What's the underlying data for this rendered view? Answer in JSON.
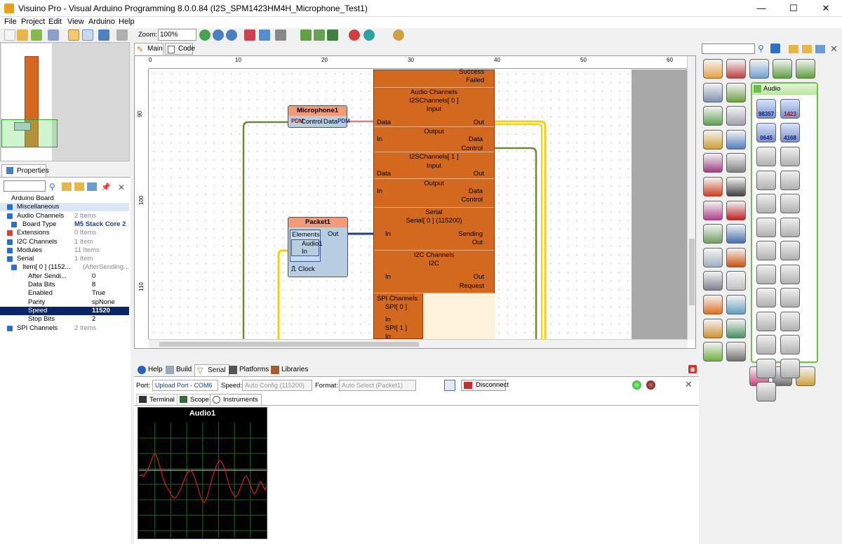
{
  "window": {
    "title": "Visuino Pro - Visual Arduino Programming 8.0.0.84 (I2S_SPM1423HM4H_Microphone_Test1)",
    "min": "—",
    "max": "☐",
    "close": "✕"
  },
  "menu": [
    "File",
    "Project",
    "Edit",
    "View",
    "Arduino",
    "Help"
  ],
  "toolbar": {
    "zoom_label": "Zoom:",
    "zoom_value": "100%"
  },
  "props": {
    "tab": "Properties",
    "rows": [
      {
        "label": "Arduino Board",
        "value": "",
        "indent": 0
      },
      {
        "label": "Miscellaneous",
        "value": "",
        "indent": 1
      },
      {
        "label": "Audio Channels",
        "value": "2 Items",
        "indent": 1
      },
      {
        "label": "Board Type",
        "value": "M5 Stack Core 2",
        "indent": 2
      },
      {
        "label": "Extensions",
        "value": "0 Items",
        "indent": 1
      },
      {
        "label": "I2C Channels",
        "value": "1 Item",
        "indent": 1
      },
      {
        "label": "Modules",
        "value": "11 Items",
        "indent": 1
      },
      {
        "label": "Serial",
        "value": "1 Item",
        "indent": 1
      },
      {
        "label": "Item[ 0 ] (1152...",
        "value": "(AfterSending...",
        "indent": 2
      },
      {
        "label": "After Sendi...",
        "value": "0",
        "indent": 3
      },
      {
        "label": "Data Bits",
        "value": "8",
        "indent": 3
      },
      {
        "label": "Enabled",
        "value": "True",
        "indent": 3
      },
      {
        "label": "Parity",
        "value": "spNone",
        "indent": 3
      },
      {
        "label": "Speed",
        "value": "11520",
        "indent": 3
      },
      {
        "label": "Stop Bits",
        "value": "2",
        "indent": 3
      },
      {
        "label": "SPI Channels",
        "value": "2 Items",
        "indent": 1
      }
    ]
  },
  "editor": {
    "tabs": [
      "Main",
      "Code"
    ],
    "ruler_top": [
      "0",
      "10",
      "20",
      "30",
      "40",
      "50",
      "60"
    ],
    "ruler_left": [
      "90",
      "100",
      "110"
    ]
  },
  "blocks": {
    "microphone": {
      "title": "Microphone1",
      "pin_in": "Control",
      "pin_out": "Data"
    },
    "packet": {
      "title": "Packet1",
      "elements": "Elements",
      "out": "Out",
      "audio": "Audio1",
      "in": "In",
      "clock": "Clock"
    },
    "board": {
      "success": "Success",
      "failed": "Failed",
      "audio_channels": "Audio Channels",
      "i2s0": "I2SChannels[ 0 ]",
      "input": "Input",
      "data": "Data",
      "out": "Out",
      "output": "Output",
      "in": "In",
      "control": "Control",
      "i2s1": "I2SChannels[ 1 ]",
      "serial": "Serial",
      "serial0": "Serial[ 0 ] (115200)",
      "sending": "Sending",
      "i2c_channels": "I2C Channels",
      "i2c": "I2C",
      "request": "Request",
      "spi_channels": "SPI Channels",
      "spi0": "SPI[ 0 ]",
      "spi1": "SPI[ 1 ]"
    }
  },
  "bottom": {
    "tabs": [
      "Help",
      "Build",
      "Serial",
      "Platforms",
      "Libraries"
    ],
    "port_label": "Port:",
    "port_value": "Upload Port - COM6",
    "speed_label": "Speed:",
    "speed_value": "Auto Config (115200)",
    "format_label": "Format:",
    "format_value": "Auto Select (Packet1)",
    "disconnect": "Disconnect",
    "subtabs": [
      "Terminal",
      "Scope",
      "Instruments"
    ],
    "scope_title": "Audio1"
  },
  "palette": {
    "group_title": "Audio",
    "tiles": [
      "98357",
      "1423",
      "0645",
      "4168"
    ]
  },
  "colors": {
    "block_orange": "#d2691e",
    "wire_yellow": "#f2d20a",
    "wire_green": "#6a8a3a",
    "scope_trace": "#c02020"
  },
  "scope_data": [
    0.45,
    0.46,
    0.44,
    0.47,
    0.42,
    0.4,
    0.36,
    0.3,
    0.24,
    0.18,
    0.14,
    0.16,
    0.22,
    0.3,
    0.38,
    0.46,
    0.52,
    0.58,
    0.62,
    0.66,
    0.7,
    0.74,
    0.76,
    0.78,
    0.76,
    0.72,
    0.68,
    0.64,
    0.58,
    0.52,
    0.46,
    0.42,
    0.4,
    0.38,
    0.4,
    0.44,
    0.5,
    0.56,
    0.64,
    0.72,
    0.78,
    0.82,
    0.84,
    0.8,
    0.74,
    0.66,
    0.58,
    0.5,
    0.42,
    0.36,
    0.3,
    0.26,
    0.24,
    0.26,
    0.3,
    0.36,
    0.44,
    0.52,
    0.6,
    0.66,
    0.7,
    0.74,
    0.76,
    0.74,
    0.7,
    0.64,
    0.58,
    0.52,
    0.48,
    0.46,
    0.5,
    0.56,
    0.62,
    0.68,
    0.72,
    0.7,
    0.64,
    0.58,
    0.54,
    0.56,
    0.62,
    0.66,
    0.6
  ]
}
